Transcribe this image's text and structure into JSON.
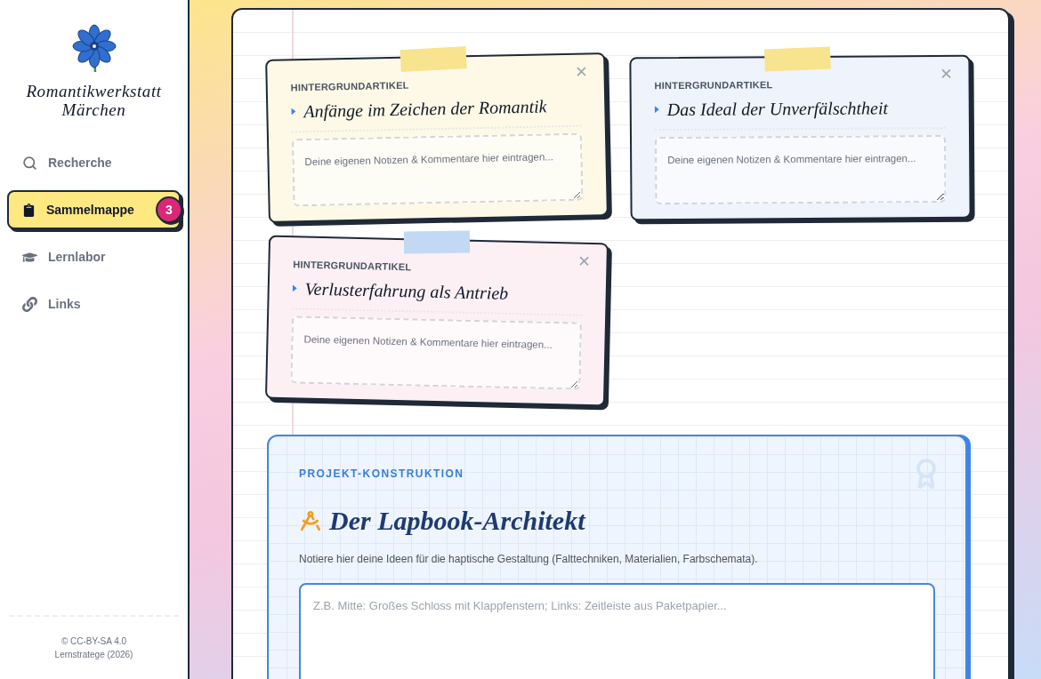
{
  "sidebar": {
    "title": "Romantikwerkstatt Märchen",
    "nav": [
      {
        "label": "Recherche",
        "selected": false
      },
      {
        "label": "Sammelmappe",
        "selected": true,
        "badge": "3"
      },
      {
        "label": "Lernlabor",
        "selected": false
      },
      {
        "label": "Links",
        "selected": false
      }
    ],
    "footer": [
      "© CC-BY-SA 4.0",
      "Lernstratege (2026)"
    ]
  },
  "cards": [
    {
      "category": "HINTERGRUNDARTIKEL",
      "title": "Anfänge im Zeichen der Romantik",
      "placeholder": "Deine eigenen Notizen & Kommentare hier eintragen...",
      "color": "#fdf9e6",
      "tape": {
        "color": "#f8e38e"
      }
    },
    {
      "category": "HINTERGRUNDARTIKEL",
      "title": "Das Ideal der Unverfälschtheit",
      "placeholder": "Deine eigenen Notizen & Kommentare hier eintragen...",
      "color": "#eef3fc",
      "tape": {
        "color": "#f8e38e"
      }
    },
    {
      "category": "HINTERGRUNDARTIKEL",
      "title": "Verlusterfahrung als Antrieb",
      "placeholder": "Deine eigenen Notizen & Kommentare hier eintragen...",
      "color": "#fcf0f5",
      "tape": {
        "color": "#c3d9f3"
      }
    }
  ],
  "project": {
    "eyebrow": "PROJEKT-KONSTRUKTION",
    "title": "Der Lapbook-Architekt",
    "description": "Notiere hier deine Ideen für die haptische Gestaltung (Falttechniken, Materialien, Farbschemata).",
    "placeholder": "Z.B. Mitte: Großes Schloss mit Klappfenstern; Links: Zeitleiste aus Paketpapier..."
  }
}
